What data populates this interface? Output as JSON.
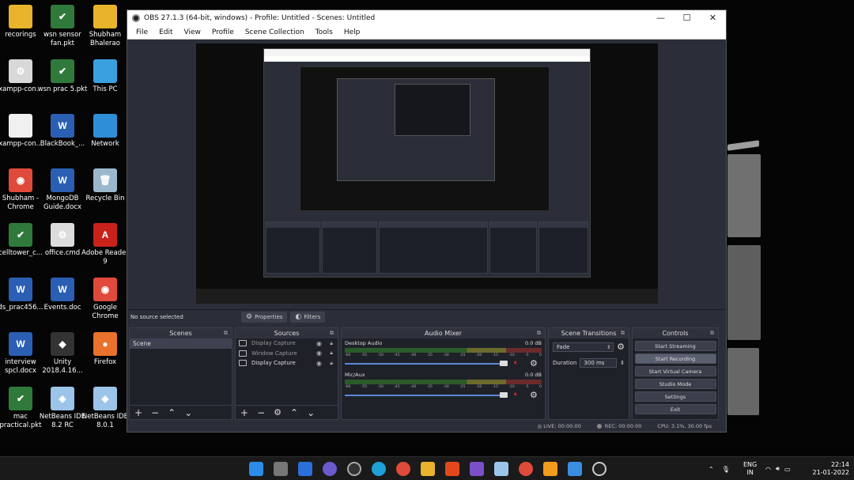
{
  "desktop": {
    "icons": [
      {
        "label": "recorings",
        "color": "#e9b42c",
        "glyph": ""
      },
      {
        "label": "wsn sensor fan.pkt",
        "color": "#2f7a3b",
        "glyph": "✔"
      },
      {
        "label": "Shubham Bhalerao",
        "color": "#e9b42c",
        "glyph": ""
      },
      {
        "label": "xampp-con...",
        "color": "#d8d8d8",
        "glyph": "⚙"
      },
      {
        "label": "wsn prac 5.pkt",
        "color": "#2f7a3b",
        "glyph": "✔"
      },
      {
        "label": "This PC",
        "color": "#3aa0e0",
        "glyph": ""
      },
      {
        "label": "xampp-con...",
        "color": "#f0f0f0",
        "glyph": ""
      },
      {
        "label": "BlackBook_...",
        "color": "#2b5fb3",
        "glyph": "W"
      },
      {
        "label": "Network",
        "color": "#2e8fd8",
        "glyph": ""
      },
      {
        "label": "Shubham - Chrome",
        "color": "#e04a3a",
        "glyph": "◉"
      },
      {
        "label": "MongoDB Guide.docx",
        "color": "#2b5fb3",
        "glyph": "W"
      },
      {
        "label": "Recycle Bin",
        "color": "#9bb7cc",
        "glyph": "🗑"
      },
      {
        "label": "celltower_c...",
        "color": "#2f7a3b",
        "glyph": "✔"
      },
      {
        "label": "office.cmd",
        "color": "#dcdcdc",
        "glyph": "⚙"
      },
      {
        "label": "Adobe Reader 9",
        "color": "#c9221b",
        "glyph": "A"
      },
      {
        "label": "ds_prac456...",
        "color": "#2b5fb3",
        "glyph": "W"
      },
      {
        "label": "Events.doc",
        "color": "#2b5fb3",
        "glyph": "W"
      },
      {
        "label": "Google Chrome",
        "color": "#e04a3a",
        "glyph": "◉"
      },
      {
        "label": "interview spcl.docx",
        "color": "#2b5fb3",
        "glyph": "W"
      },
      {
        "label": "Unity 2018.4.16...",
        "color": "#333",
        "glyph": "◆"
      },
      {
        "label": "Firefox",
        "color": "#e8722b",
        "glyph": "●"
      },
      {
        "label": "mac practical.pkt",
        "color": "#2f7a3b",
        "glyph": "✔"
      },
      {
        "label": "NetBeans IDE 8.2 RC",
        "color": "#9cc4e8",
        "glyph": "◈"
      },
      {
        "label": "NetBeans IDE 8.0.1",
        "color": "#9cc4e8",
        "glyph": "◈"
      }
    ]
  },
  "window": {
    "title": "OBS 27.1.3 (64-bit, windows) - Profile: Untitled - Scenes: Untitled",
    "menu": [
      "File",
      "Edit",
      "View",
      "Profile",
      "Scene Collection",
      "Tools",
      "Help"
    ],
    "minimize": "—",
    "maximize": "☐",
    "close": "✕"
  },
  "source_bar": {
    "no_source": "No source selected",
    "properties": "Properties",
    "filters": "Filters"
  },
  "scenes": {
    "header": "Scenes",
    "items": [
      "Scene"
    ]
  },
  "sources": {
    "header": "Sources",
    "items": [
      "Display Capture",
      "Window Capture",
      "Display Capture"
    ]
  },
  "mixer": {
    "header": "Audio Mixer",
    "channels": [
      {
        "name": "Desktop Audio",
        "db": "0.0 dB"
      },
      {
        "name": "Mic/Aux",
        "db": "0.0 dB"
      }
    ],
    "ticks": [
      "-60",
      "-55",
      "-50",
      "-45",
      "-40",
      "-35",
      "-30",
      "-25",
      "-20",
      "-15",
      "-10",
      "-5",
      "0"
    ]
  },
  "transitions": {
    "header": "Scene Transitions",
    "type": "Fade",
    "duration_label": "Duration",
    "duration_value": "300 ms"
  },
  "controls": {
    "header": "Controls",
    "buttons": [
      "Start Streaming",
      "Start Recording",
      "Start Virtual Camera",
      "Studio Mode",
      "Settings",
      "Exit"
    ]
  },
  "status": {
    "live": "LIVE: 00:00:00",
    "rec": "REC: 00:00:00",
    "cpu": "CPU: 3.1%, 30.00 fps"
  },
  "taskbar": {
    "lang": "ENG",
    "region": "IN",
    "time": "22:14",
    "date": "21-01-2022"
  }
}
